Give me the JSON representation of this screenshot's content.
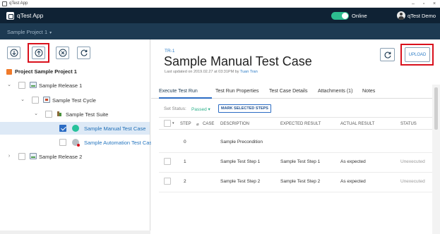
{
  "window": {
    "title": "qTest App"
  },
  "header": {
    "app_name": "qTest App",
    "online_label": "Online",
    "user_name": "qTest Demo"
  },
  "project_bar": {
    "selected_project": "Sample Project 1",
    "caret": "▾"
  },
  "left_panel": {
    "toolbar": [
      {
        "name": "download-button",
        "icon": "arrow-down-circle-icon",
        "highlighted": false
      },
      {
        "name": "upload-button",
        "icon": "arrow-up-circle-icon",
        "highlighted": true
      },
      {
        "name": "remove-button",
        "icon": "x-circle-icon",
        "highlighted": false
      },
      {
        "name": "refresh-button",
        "icon": "refresh-icon",
        "highlighted": false
      }
    ],
    "project_label": "Project Sample Project 1",
    "tree": [
      {
        "label": "Sample Release 1",
        "type": "release",
        "expanded": true
      },
      {
        "label": "Sample Test Cycle",
        "type": "cycle",
        "expanded": true
      },
      {
        "label": "Sample Test Suite",
        "type": "suite",
        "expanded": true
      },
      {
        "label": "Sample Manual Test Case",
        "type": "test-run",
        "selected": true,
        "checked": true
      },
      {
        "label": "Sample Automation Test Case",
        "type": "test-run",
        "selected": false,
        "checked": false
      },
      {
        "label": "Sample Release 2",
        "type": "release",
        "expanded": false
      }
    ]
  },
  "detail": {
    "id": "TR-1",
    "title": "Sample Manual Test Case",
    "updated_prefix": "Last updated on 2019.02.27 at 03:31PM by ",
    "updated_by": "Tuan Tran",
    "upload_label": "UPLOAD",
    "tabs": [
      "Execute Test Run",
      "Test Run Properties",
      "Test Case Details",
      "Attachments (1)",
      "Notes"
    ],
    "active_tab": "Execute Test Run",
    "set_status_label": "Set Status:",
    "status_value": "Passed ▾",
    "mark_button_label": "MARK SELECTED STEPS",
    "columns": [
      "STEP",
      "CASE",
      "DESCRIPTION",
      "EXPECTED RESULT",
      "ACTUAL RESULT",
      "STATUS"
    ],
    "rows": [
      {
        "step": "0",
        "description": "Sample Precondition",
        "expected": "",
        "actual": "",
        "status": ""
      },
      {
        "step": "1",
        "description": "Sample Test Step 1",
        "expected": "Sample Test Step 1",
        "actual": "As expected",
        "status": "Unexecuted"
      },
      {
        "step": "2",
        "description": "Sample Test Step 2",
        "expected": "Sample Test Step 2",
        "actual": "As expected",
        "status": "Unexecuted"
      }
    ]
  },
  "colors": {
    "header_bg": "#0f2234",
    "project_bar_bg": "#1d3a52",
    "accent": "#2b6cc4",
    "online_toggle": "#2dbd8f",
    "highlight_box": "#d9101c"
  }
}
